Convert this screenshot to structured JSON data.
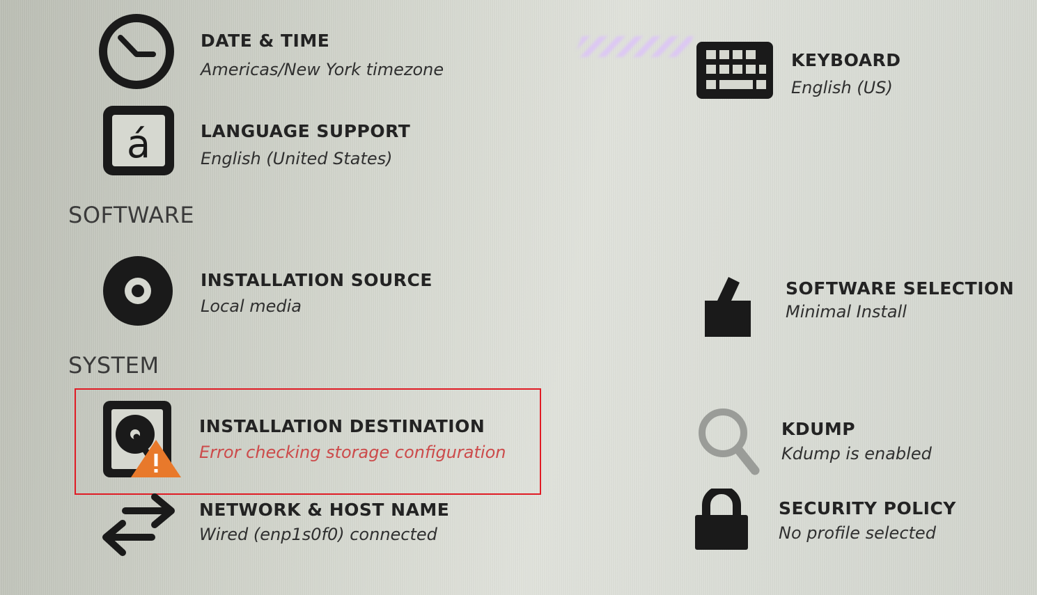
{
  "categories": {
    "software": "SOFTWARE",
    "system": "SYSTEM"
  },
  "spokes": {
    "date_time": {
      "title": "DATE & TIME",
      "status": "Americas/New York timezone",
      "icon": "clock-icon"
    },
    "keyboard": {
      "title": "KEYBOARD",
      "status": "English (US)",
      "icon": "keyboard-icon"
    },
    "language_support": {
      "title": "LANGUAGE SUPPORT",
      "status": "English (United States)",
      "icon": "language-icon"
    },
    "installation_source": {
      "title": "INSTALLATION SOURCE",
      "status": "Local media",
      "icon": "disc-icon"
    },
    "software_selection": {
      "title": "SOFTWARE SELECTION",
      "status": "Minimal Install",
      "icon": "package-icon"
    },
    "installation_destination": {
      "title": "INSTALLATION DESTINATION",
      "status": "Error checking storage configuration",
      "icon": "harddisk-warning-icon",
      "status_state": "error"
    },
    "kdump": {
      "title": "KDUMP",
      "status": "Kdump is enabled",
      "icon": "magnifier-icon"
    },
    "network_hostname": {
      "title": "NETWORK & HOST NAME",
      "status": "Wired (enp1s0f0) connected",
      "icon": "network-arrows-icon"
    },
    "security_policy": {
      "title": "SECURITY POLICY",
      "status": "No profile selected",
      "icon": "lock-icon"
    }
  },
  "colors": {
    "error_text": "#cc4a4a",
    "highlight_border": "#e01b24",
    "warning_triangle": "#e8792b"
  }
}
